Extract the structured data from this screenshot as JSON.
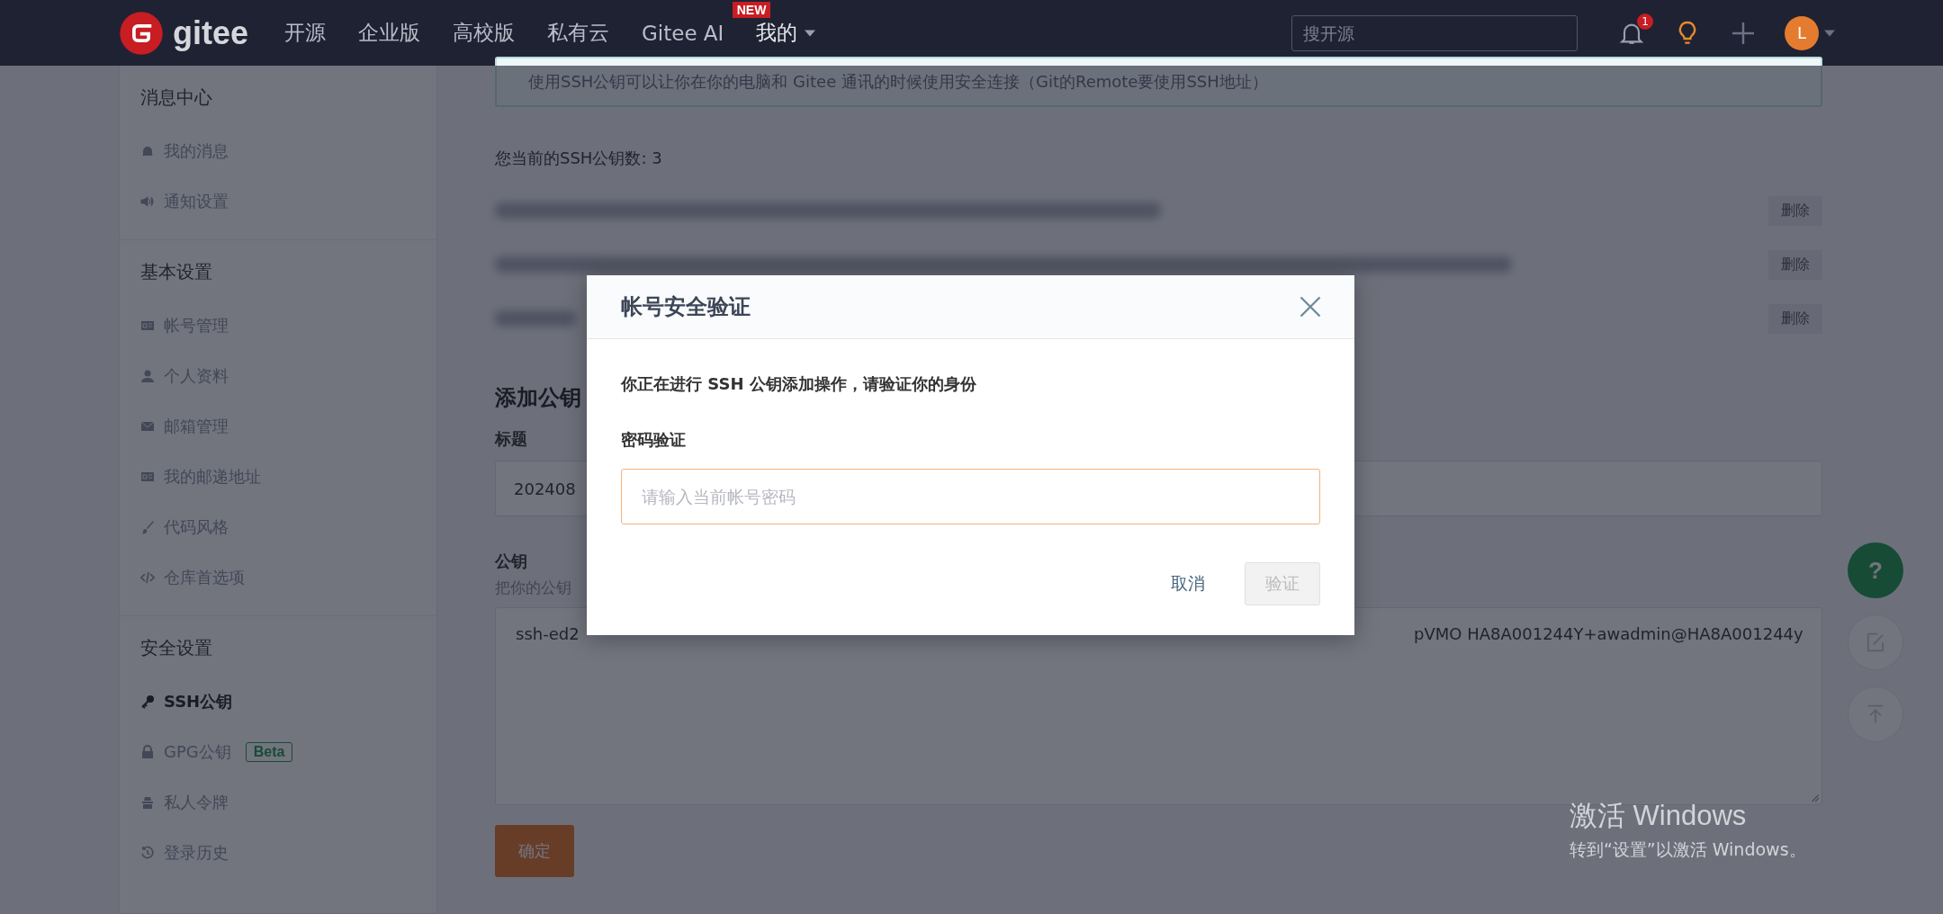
{
  "navbar": {
    "logo": "gitee",
    "links": [
      {
        "label": "开源"
      },
      {
        "label": "企业版"
      },
      {
        "label": "高校版"
      },
      {
        "label": "私有云"
      },
      {
        "label": "Gitee AI",
        "badge": "NEW"
      }
    ],
    "user_menu": "我的",
    "search": {
      "placeholder": "搜开源"
    },
    "notification_count": "1",
    "avatar_letter": "L"
  },
  "sidebar": {
    "sections": [
      {
        "title": "消息中心",
        "items": [
          {
            "label": "我的消息",
            "selected": false
          },
          {
            "label": "通知设置",
            "selected": false
          }
        ]
      },
      {
        "title": "基本设置",
        "items": [
          {
            "label": "帐号管理",
            "selected": false
          },
          {
            "label": "个人资料",
            "selected": false
          },
          {
            "label": "邮箱管理",
            "selected": false
          },
          {
            "label": "我的邮递地址",
            "selected": false
          },
          {
            "label": "代码风格",
            "selected": false
          },
          {
            "label": "仓库首选项",
            "selected": false
          }
        ]
      },
      {
        "title": "安全设置",
        "items": [
          {
            "label": "SSH公钥",
            "selected": true
          },
          {
            "label": "GPG公钥",
            "selected": false,
            "badge": "Beta"
          },
          {
            "label": "私人令牌",
            "selected": false
          },
          {
            "label": "登录历史",
            "selected": false
          }
        ]
      }
    ]
  },
  "main": {
    "info": "使用SSH公钥可以让你在你的电脑和 Gitee 通讯的时候使用安全连接（Git的Remote要使用SSH地址）",
    "key_count": "您当前的SSH公钥数: 3",
    "ssh_keys": [
      {
        "delete_label": "删除"
      },
      {
        "delete_label": "删除"
      },
      {
        "delete_label": "删除"
      }
    ],
    "add_heading": "添加公钥",
    "title_label": "标题",
    "title_value": "202408",
    "key_label": "公钥",
    "key_hint": "把你的公钥",
    "key_value_start": "ssh-ed2",
    "key_value_end": "pVMO HA8A001244Y+awadmin@HA8A001244y",
    "submit": "确定"
  },
  "float_buttons": [
    {
      "kind": "help",
      "label": "?"
    },
    {
      "kind": "edit"
    },
    {
      "kind": "top"
    }
  ],
  "dialog": {
    "title": "帐号安全验证",
    "message": "你正在进行 SSH 公钥添加操作，请验证你的身份",
    "field_label": "密码验证",
    "placeholder": "请输入当前帐号密码",
    "cancel": "取消",
    "confirm": "验证",
    "confirm_disabled": true
  },
  "windows_activation": {
    "title": "激活 Windows",
    "hint": "转到“设置”以激活 Windows。"
  }
}
